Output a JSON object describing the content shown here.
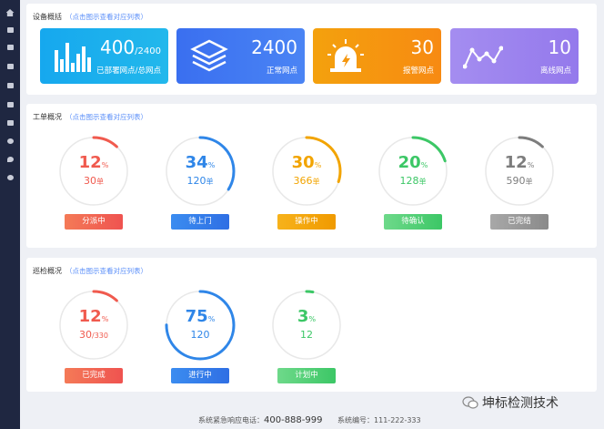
{
  "device_overview": {
    "title": "设备概括",
    "hint": "（点击图示查看对应列表）",
    "cards": [
      {
        "value": "400",
        "total": "/2400",
        "label": "已部署网点/总网点",
        "icon": "bar-chart-icon",
        "color": "#1aa6ea"
      },
      {
        "value": "2400",
        "label": "正常网点",
        "icon": "layers-icon",
        "color": "#3f74ee"
      },
      {
        "value": "30",
        "label": "报警网点",
        "icon": "alarm-light-icon",
        "color": "#f5960d"
      },
      {
        "value": "10",
        "label": "离线网点",
        "icon": "line-trend-icon",
        "color": "#9d86ee"
      }
    ]
  },
  "work_orders": {
    "title": "工单概况",
    "hint": "（点击图示查看对应列表）",
    "items": [
      {
        "pct": 12,
        "pct_unit": "%",
        "count": "30",
        "count_unit": "单",
        "label": "分派中",
        "color": "#f05a4e"
      },
      {
        "pct": 34,
        "pct_unit": "%",
        "count": "120",
        "count_unit": "单",
        "label": "待上门",
        "color": "#2f86e8"
      },
      {
        "pct": 30,
        "pct_unit": "%",
        "count": "366",
        "count_unit": "单",
        "label": "操作中",
        "color": "#f2a400"
      },
      {
        "pct": 20,
        "pct_unit": "%",
        "count": "128",
        "count_unit": "单",
        "label": "待确认",
        "color": "#3cc766"
      },
      {
        "pct": 12,
        "pct_unit": "%",
        "count": "590",
        "count_unit": "单",
        "label": "已完结",
        "color": "#7d7d7d"
      }
    ]
  },
  "inspection": {
    "title": "巡检概况",
    "hint": "（点击图示查看对应列表）",
    "items": [
      {
        "pct": 12,
        "pct_unit": "%",
        "count": "30",
        "count_unit": "/330",
        "label": "已完成",
        "color": "#f05a4e"
      },
      {
        "pct": 75,
        "pct_unit": "%",
        "count": "120",
        "count_unit": "",
        "label": "进行中",
        "color": "#2f86e8"
      },
      {
        "pct": 3,
        "pct_unit": "%",
        "count": "12",
        "count_unit": "",
        "label": "计划中",
        "color": "#3cc766"
      }
    ]
  },
  "footer": {
    "hotline_label": "系统紧急响应电话：",
    "hotline": "400-888-999",
    "sysno_label": "系统编号：",
    "sysno": "111-222-333"
  },
  "watermark": {
    "text": "坤标检测技术",
    "icon": "wechat-icon"
  },
  "sidebar": {
    "icons": [
      "home-icon",
      "list-icon",
      "device-icon",
      "calendar-icon",
      "monitor-icon",
      "message-icon",
      "chart-icon",
      "info-icon",
      "location-icon",
      "settings-icon"
    ]
  }
}
